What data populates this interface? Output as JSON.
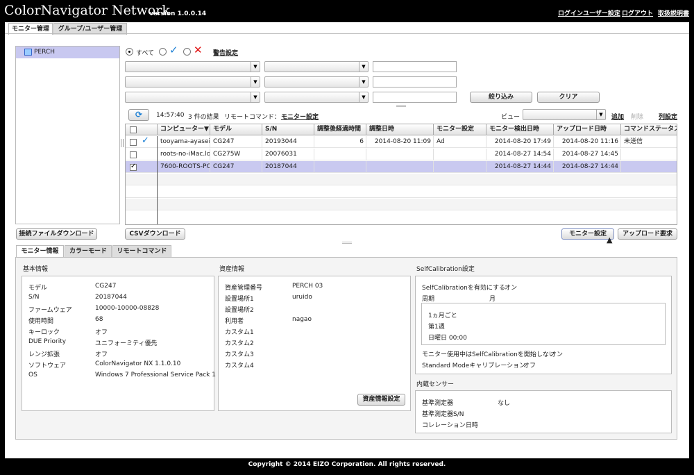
{
  "header": {
    "logo": "ColorNavigator Network",
    "version": "version 1.0.0.14",
    "links": [
      "ログインユーザー設定",
      "ログアウト",
      "取扱説明書"
    ]
  },
  "top_tabs": [
    "モニター管理",
    "グループ/ユーザー管理"
  ],
  "tree": {
    "root": "PERCH"
  },
  "filter": {
    "all": "すべて",
    "alert_settings": "警告設定",
    "narrow_button": "絞り込み",
    "clear_button": "クリア"
  },
  "toolbar": {
    "time": "14:57:40",
    "result_count": "3 件の結果",
    "remote_label": "リモートコマンド：",
    "monitor_settings_link": "モニター設定",
    "view_label": "ビュー",
    "add": "追加",
    "delete": "削除",
    "column_settings": "列設定"
  },
  "table": {
    "columns": [
      "コンピューター▼",
      "モデル",
      "S/N",
      "調整後経過時間",
      "調整日時",
      "モニター設定",
      "モニター検出日時",
      "アップロード日時",
      "コマンドステータス"
    ],
    "rows": [
      {
        "checked": false,
        "status": "ok",
        "cells": [
          "tooyama-ayasei-",
          "CG247",
          "20193044",
          "6",
          "2014-08-20 11:09",
          "Ad",
          "2014-08-20 17:49",
          "2014-08-20 11:16",
          "未送信"
        ]
      },
      {
        "checked": false,
        "status": "",
        "cells": [
          "roots-no-iMac.lo",
          "CG275W",
          "20076031",
          "",
          "",
          "",
          "2014-08-27 14:54",
          "2014-08-27 14:45",
          ""
        ]
      },
      {
        "checked": true,
        "status": "",
        "cells": [
          "7600-ROOTS-PC",
          "CG247",
          "20187044",
          "",
          "",
          "",
          "2014-08-27 14:44",
          "2014-08-27 14:44",
          ""
        ]
      }
    ]
  },
  "buttons": {
    "download_conn": "接続ファイルダウンロード",
    "csv": "CSVダウンロード",
    "monitor_settings": "モニター設定",
    "upload_request": "アップロード要求"
  },
  "detail_tabs": [
    "モニター情報",
    "カラーモード",
    "リモートコマンド"
  ],
  "basic_info": {
    "title": "基本情報",
    "items": [
      {
        "k": "モデル",
        "v": "CG247"
      },
      {
        "k": "S/N",
        "v": "20187044"
      },
      {
        "k": "ファームウェア",
        "v": "10000-10000-08828"
      },
      {
        "k": "使用時間",
        "v": "68"
      },
      {
        "k": "キーロック",
        "v": "オフ"
      },
      {
        "k": "DUE Priority",
        "v": "ユニフォーミティ優先"
      },
      {
        "k": "レンジ拡張",
        "v": "オフ"
      },
      {
        "k": "ソフトウェア",
        "v": "ColorNavigator NX 1.1.0.10"
      },
      {
        "k": "OS",
        "v": "Windows 7 Professional Service Pack 1"
      }
    ]
  },
  "asset_info": {
    "title": "資産情報",
    "items": [
      {
        "k": "資産管理番号",
        "v": "PERCH 03"
      },
      {
        "k": "設置場所1",
        "v": "uruido"
      },
      {
        "k": "設置場所2",
        "v": ""
      },
      {
        "k": "利用者",
        "v": "nagao"
      },
      {
        "k": "カスタム1",
        "v": ""
      },
      {
        "k": "カスタム2",
        "v": ""
      },
      {
        "k": "カスタム3",
        "v": ""
      },
      {
        "k": "カスタム4",
        "v": ""
      }
    ],
    "button": "資産情報設定"
  },
  "selfcal": {
    "title": "SelfCalibration設定",
    "enable_label": "SelfCalibrationを有効にする",
    "enable_value": "オン",
    "period_label": "周期",
    "period_value": "月",
    "schedule": [
      "1ヵ月ごと",
      "第1週",
      "日曜日 00:00"
    ],
    "inuse_label": "モニター使用中はSelfCalibrationを開始しない",
    "inuse_value": "オン",
    "std_label": "Standard Modeキャリブレーション",
    "std_value": "オフ"
  },
  "sensor": {
    "title": "内蔵センサー",
    "items": [
      {
        "k": "基準測定器",
        "v": "なし"
      },
      {
        "k": "基準測定器S/N",
        "v": ""
      },
      {
        "k": "コレレーション日時",
        "v": ""
      }
    ]
  },
  "footer": "Copyright © 2014 EIZO Corporation. All rights reserved.",
  "colors": {
    "selected_row": "#c9c9f0",
    "tree_selected": "#c8c8f0",
    "check_blue": "#1a7fd4",
    "x_red": "#e01010"
  }
}
